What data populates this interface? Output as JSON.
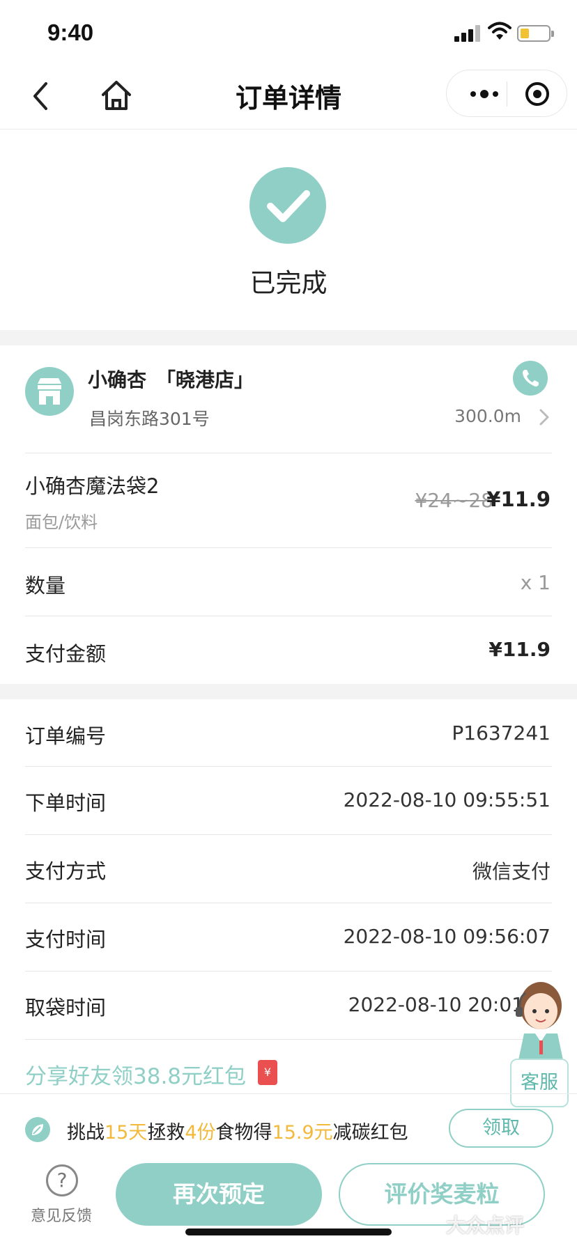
{
  "status_bar": {
    "time": "9:40"
  },
  "nav": {
    "title": "订单详情"
  },
  "order_status": {
    "text": "已完成"
  },
  "store": {
    "name": "小确杏　「晓港店」",
    "address": "昌岗东路301号",
    "distance": "300.0m"
  },
  "product": {
    "name": "小确杏魔法袋2",
    "category": "面包/饮料",
    "original_price": "¥24~28",
    "price": "¥11.9"
  },
  "quantity": {
    "label": "数量",
    "value": "x 1"
  },
  "payment_amount": {
    "label": "支付金额",
    "value": "¥11.9"
  },
  "details": [
    {
      "label": "订单编号",
      "value": "P1637241"
    },
    {
      "label": "下单时间",
      "value": "2022-08-10 09:55:51"
    },
    {
      "label": "支付方式",
      "value": "微信支付"
    },
    {
      "label": "支付时间",
      "value": "2022-08-10 09:56:07"
    },
    {
      "label": "取袋时间",
      "value": "2022-08-10 20:01"
    }
  ],
  "share": {
    "text": "分享好友领38.8元红包",
    "packet_symbol": "¥"
  },
  "challenge": {
    "t1": "挑战",
    "days": "15天",
    "t2": "拯救",
    "portions": "4份",
    "t3": "食物得",
    "amount": "15.9元",
    "t4": "减碳红包",
    "button": "领取"
  },
  "footer": {
    "feedback_icon": "?",
    "feedback_label": "意见反馈",
    "rebook": "再次预定",
    "review": "评价奖麦粒"
  },
  "customer_service": {
    "label": "客服"
  },
  "watermark": "大众点评",
  "colors": {
    "accent": "#8fcfc6",
    "highlight": "#f2b93b",
    "red_packet": "#e9504f"
  }
}
